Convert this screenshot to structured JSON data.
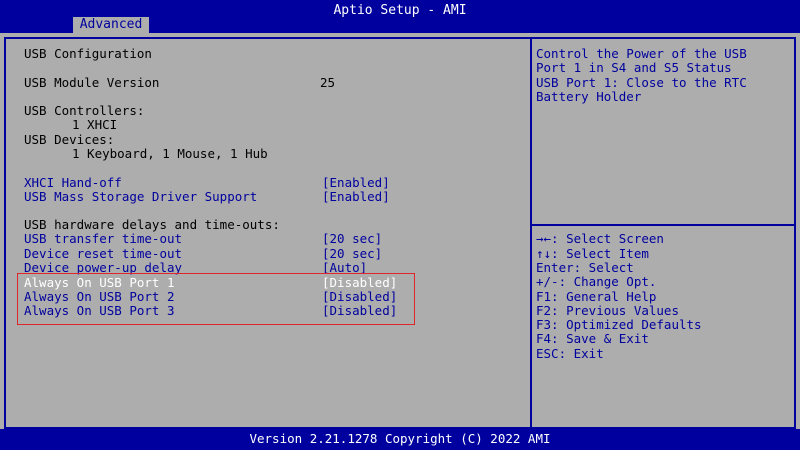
{
  "header": {
    "title": "Aptio Setup - AMI",
    "tab": "Advanced"
  },
  "main": {
    "section_title": "USB Configuration",
    "module_version": {
      "label": "USB Module Version",
      "value": "25"
    },
    "controllers_label": "USB Controllers:",
    "controllers_value": "1 XHCI",
    "devices_label": "USB Devices:",
    "devices_value": "1 Keyboard, 1 Mouse, 1 Hub",
    "options": [
      {
        "label": "XHCI Hand-off",
        "value": "[Enabled]"
      },
      {
        "label": "USB Mass Storage Driver Support",
        "value": "[Enabled]"
      }
    ],
    "delays_label": "USB hardware delays and time-outs:",
    "delays": [
      {
        "label": "USB transfer time-out",
        "value": "[20 sec]"
      },
      {
        "label": "Device reset time-out",
        "value": "[20 sec]"
      },
      {
        "label": "Device power-up delay",
        "value": "[Auto]"
      }
    ],
    "always_on": [
      {
        "label": "Always On USB Port 1",
        "value": "[Disabled]"
      },
      {
        "label": "Always On USB Port 2",
        "value": "[Disabled]"
      },
      {
        "label": "Always On USB Port 3",
        "value": "[Disabled]"
      }
    ]
  },
  "help": {
    "lines": [
      "Control the Power of the USB",
      "Port 1 in S4 and S5 Status",
      "USB Port 1: Close to the RTC",
      "Battery Holder"
    ]
  },
  "keys": [
    "→←: Select Screen",
    "↑↓: Select Item",
    "Enter: Select",
    "+/-: Change Opt.",
    "F1: General Help",
    "F2: Previous Values",
    "F3: Optimized Defaults",
    "F4: Save & Exit",
    "ESC: Exit"
  ],
  "footer": {
    "text": "Version 2.21.1278 Copyright (C) 2022 AMI"
  },
  "colors": {
    "background": "#adadad",
    "accent": "#00009e",
    "selected_text": "#ffffff",
    "highlight_border": "#e0262d"
  }
}
